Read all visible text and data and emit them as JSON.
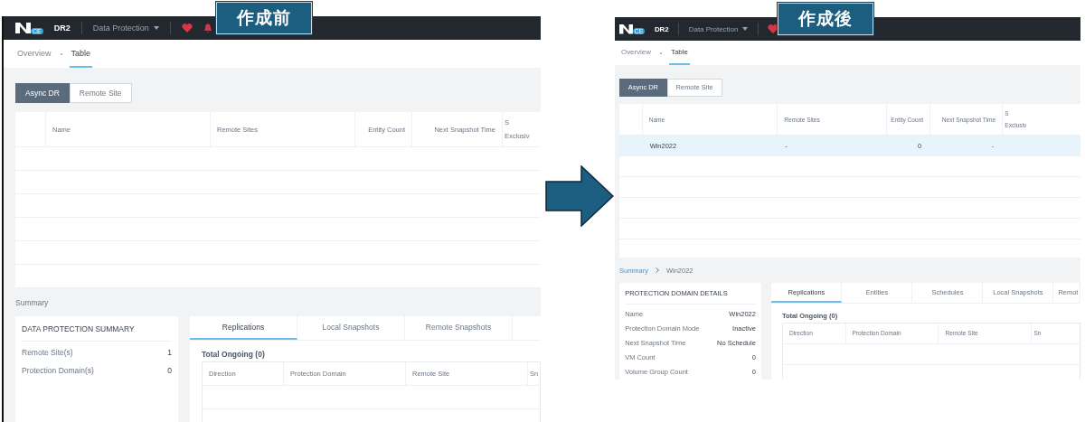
{
  "screens": [
    {
      "label": "作成前",
      "topbar": {
        "logo_badge": "CE",
        "cluster": "DR2",
        "menu": "Data Protection"
      },
      "nav_tabs": [
        {
          "label": "Overview",
          "selected": false
        },
        {
          "label": "Table",
          "selected": true
        }
      ],
      "toggle": [
        {
          "label": "Async DR",
          "selected": true
        },
        {
          "label": "Remote Site",
          "selected": false
        }
      ],
      "table": {
        "columns": [
          {
            "label": "Name"
          },
          {
            "label": "Remote Sites"
          },
          {
            "label": "Entity Count"
          },
          {
            "label": "Next Snapshot Time"
          },
          {
            "label": "S",
            "label_2": "Exclusiv"
          }
        ]
      },
      "breadcrumb": [
        {
          "label": "Summary",
          "link": false
        }
      ],
      "details": {
        "title": "DATA PROTECTION SUMMARY",
        "rows": [
          {
            "label": "Remote Site(s)",
            "value": "1"
          },
          {
            "label": "Protection Domain(s)",
            "value": "0"
          }
        ]
      },
      "detail_tabs": [
        {
          "label": "Replications",
          "selected": true
        },
        {
          "label": "Local Snapshots",
          "selected": false
        },
        {
          "label": "Remote Snapshots",
          "selected": false
        }
      ],
      "ongoing": "Total Ongoing (0)",
      "ongoing_columns": [
        "Direction",
        "Protection Domain",
        "Remote Site",
        "Sn"
      ]
    },
    {
      "label": "作成後",
      "topbar": {
        "logo_badge": "CE",
        "cluster": "DR2",
        "menu": "Data Protection"
      },
      "nav_tabs": [
        {
          "label": "Overview",
          "selected": false
        },
        {
          "label": "Table",
          "selected": true
        }
      ],
      "toggle": [
        {
          "label": "Async DR",
          "selected": true
        },
        {
          "label": "Remote Site",
          "selected": false
        }
      ],
      "table": {
        "columns": [
          {
            "label": "Name"
          },
          {
            "label": "Remote Sites"
          },
          {
            "label": "Entity Count"
          },
          {
            "label": "Next Snapshot Time"
          },
          {
            "label": "S",
            "label_2": "Exclusiv"
          }
        ],
        "rows": [
          {
            "cells": [
              "Win2022",
              "-",
              "0",
              "-"
            ],
            "selected": true
          }
        ]
      },
      "breadcrumb": [
        {
          "label": "Summary",
          "link": true
        },
        {
          "label": "Win2022",
          "link": false
        }
      ],
      "details": {
        "title": "PROTECTION DOMAIN DETAILS",
        "rows": [
          {
            "label": "Name",
            "value": "Win2022"
          },
          {
            "label": "Protection Domain Mode",
            "value": "Inactive"
          },
          {
            "label": "Next Snapshot Time",
            "value": "No Schedule"
          },
          {
            "label": "VM Count",
            "value": "0"
          },
          {
            "label": "Volume Group Count",
            "value": "0"
          }
        ]
      },
      "detail_tabs": [
        {
          "label": "Replications",
          "selected": true
        },
        {
          "label": "Entities",
          "selected": false
        },
        {
          "label": "Schedules",
          "selected": false
        },
        {
          "label": "Local Snapshots",
          "selected": false
        },
        {
          "label": "Remot",
          "selected": false
        }
      ],
      "ongoing": "Total Ongoing (0)",
      "ongoing_columns": [
        "Direction",
        "Protection Domain",
        "Remote Site",
        "Sn"
      ]
    }
  ]
}
